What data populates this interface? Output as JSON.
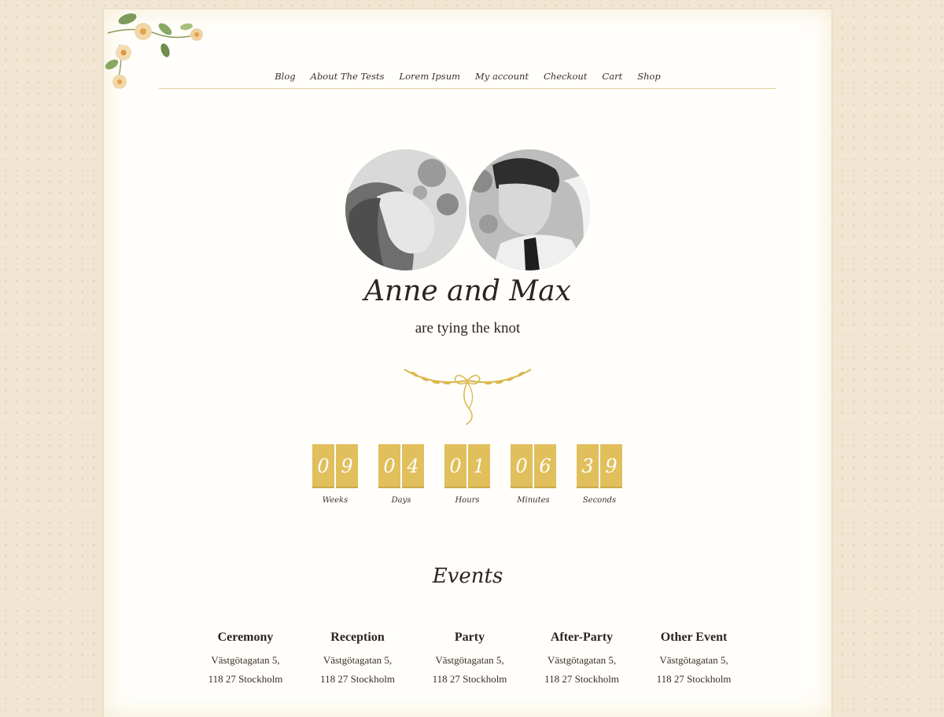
{
  "nav": [
    "Blog",
    "About The Tests",
    "Lorem Ipsum",
    "My account",
    "Checkout",
    "Cart",
    "Shop"
  ],
  "hero": {
    "names": "Anne and Max",
    "tagline": "are tying the knot"
  },
  "countdown": [
    {
      "digits": [
        "0",
        "9"
      ],
      "label": "Weeks"
    },
    {
      "digits": [
        "0",
        "4"
      ],
      "label": "Days"
    },
    {
      "digits": [
        "0",
        "1"
      ],
      "label": "Hours"
    },
    {
      "digits": [
        "0",
        "6"
      ],
      "label": "Minutes"
    },
    {
      "digits": [
        "3",
        "9"
      ],
      "label": "Seconds"
    }
  ],
  "events_title": "Events",
  "events": [
    {
      "name": "Ceremony",
      "line1": "Västgötagatan 5,",
      "line2": "118 27 Stockholm"
    },
    {
      "name": "Reception",
      "line1": "Västgötagatan 5,",
      "line2": "118 27 Stockholm"
    },
    {
      "name": "Party",
      "line1": "Västgötagatan 5,",
      "line2": "118 27 Stockholm"
    },
    {
      "name": "After-Party",
      "line1": "Västgötagatan 5,",
      "line2": "118 27 Stockholm"
    },
    {
      "name": "Other Event",
      "line1": "Västgötagatan 5,",
      "line2": "118 27 Stockholm"
    }
  ],
  "colors": {
    "gold": "#e0bf5c",
    "text": "#2d241e",
    "page_bg": "#fffefb",
    "outer_bg": "#f1e6d2"
  }
}
